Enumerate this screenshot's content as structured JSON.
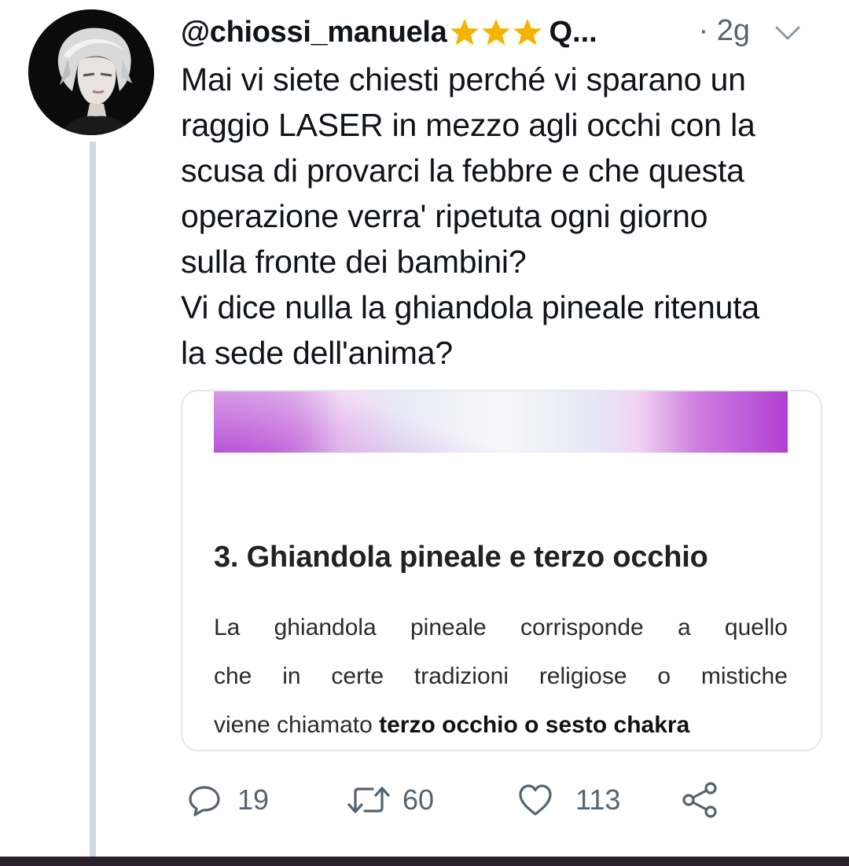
{
  "tweet": {
    "username": "@chiossi_manuela",
    "badge_icons": [
      "star-icon",
      "star-icon",
      "star-icon"
    ],
    "name_truncated": "Q...",
    "time": "· 2g",
    "text_lines": [
      "Mai vi siete chiesti perché vi sparano un",
      "raggio LASER in mezzo agli occhi con la",
      "scusa di provarci la febbre e che questa",
      "operazione verra' ripetuta ogni giorno",
      "sulla fronte dei bambini?",
      "Vi dice nulla la ghiandola pineale ritenuta",
      "la sede dell'anima?"
    ]
  },
  "card": {
    "heading": "3. Ghiandola pineale e terzo occhio",
    "body_line1": [
      "La",
      "ghiandola",
      "pineale",
      "corrisponde",
      "a",
      "quello"
    ],
    "body_line2": [
      "che",
      "in",
      "certe",
      "tradizioni",
      "religiose",
      "o",
      "mistiche"
    ],
    "body_line3_normal": "viene chiamato ",
    "body_line3_bold": "terzo occhio o sesto chakra"
  },
  "actions": {
    "replies": "19",
    "retweets": "60",
    "likes": "113"
  },
  "colors": {
    "star": "#f5b400",
    "secondary_text": "#536471",
    "thread_line": "#cfd9de",
    "bottom_bar": "#2b1f2e"
  }
}
